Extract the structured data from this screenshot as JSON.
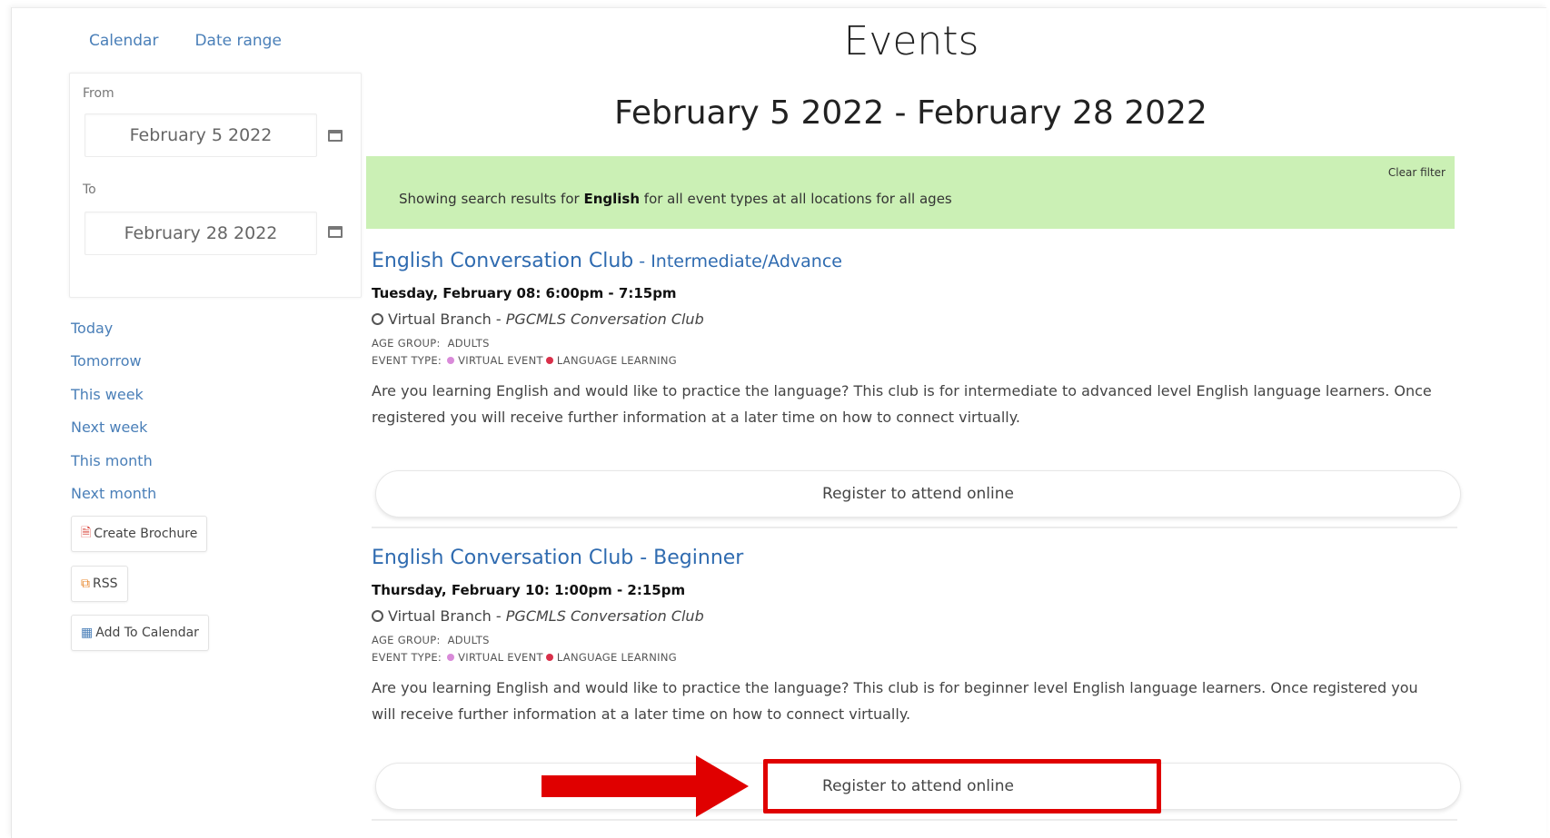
{
  "tabs": [
    "Calendar",
    "Date range"
  ],
  "date_filter": {
    "from_label": "From",
    "from_value": "February 5 2022",
    "to_label": "To",
    "to_value": "February 28 2022"
  },
  "quick_links": [
    "Today",
    "Tomorrow",
    "This week",
    "Next week",
    "This month",
    "Next month"
  ],
  "sidebar_buttons": {
    "brochure": "Create Brochure",
    "rss": "RSS",
    "calendar": "Add To Calendar"
  },
  "header": {
    "title": "Events",
    "range": "February 5 2022 - February 28 2022"
  },
  "banner": {
    "prefix": "Showing search results for ",
    "term": "English",
    "suffix": " for all event types at all locations for all ages",
    "clear": "Clear filter"
  },
  "events": [
    {
      "title": "English Conversation Club",
      "subtitle": " - Intermediate/Advance",
      "time": "Tuesday, February 08: 6:00pm - 7:15pm",
      "branch": "Virtual Branch - ",
      "room": "PGCMLS Conversation Club",
      "age_label": "AGE GROUP:",
      "age_value": "ADULTS",
      "type_label": "EVENT TYPE:",
      "type_1": "VIRTUAL EVENT",
      "type_2": "LANGUAGE LEARNING",
      "description": "Are you learning English and would like to practice the language? This club is for intermediate to advanced level English language learners. Once registered you will receive further information at a later time on how to connect virtually.",
      "button": "Register to attend online"
    },
    {
      "title": "English Conversation Club - Beginner",
      "subtitle": "",
      "time": "Thursday, February 10: 1:00pm - 2:15pm",
      "branch": "Virtual Branch - ",
      "room": "PGCMLS Conversation Club",
      "age_label": "AGE GROUP:",
      "age_value": "ADULTS",
      "type_label": "EVENT TYPE:",
      "type_1": "VIRTUAL EVENT",
      "type_2": "LANGUAGE LEARNING",
      "description": "Are you learning English and would like to practice the language? This club is for beginner level English language learners. Once registered you will receive further information at a later time on how to connect virtually.",
      "button": "Register to attend online"
    }
  ],
  "colors": {
    "link": "#4a7fb8",
    "title_link": "#2f6bb0",
    "banner_bg": "#cbf0b5",
    "virtual_dot": "#d98ad9",
    "language_dot": "#d9304a",
    "annotation": "#e00000"
  }
}
